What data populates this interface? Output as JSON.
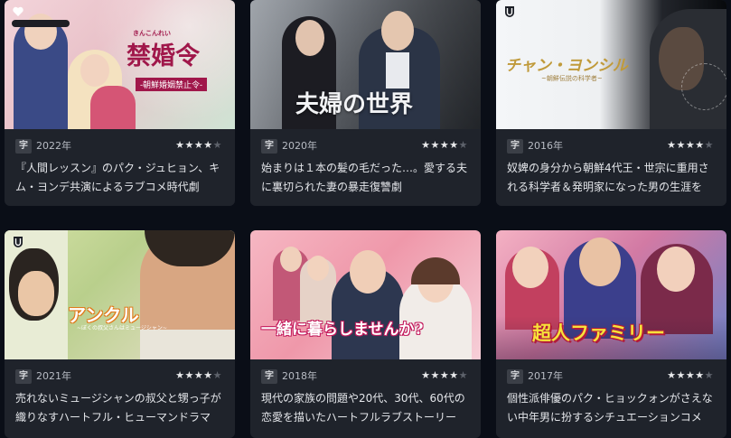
{
  "cards": [
    {
      "title_art": "禁婚令",
      "title_ruby": "きんこんれい",
      "title_sub": "-朝鮮婚姻禁止令-",
      "subtitle_badge": "字",
      "year": "2022年",
      "rating": 4,
      "description": "『人間レッスン』のパク・ジュヒョン、キム・ヨンデ共演によるラブコメ時代劇",
      "badge_icon": "heart-icon"
    },
    {
      "title_art": "夫婦の世界",
      "subtitle_badge": "字",
      "year": "2020年",
      "rating": 4,
      "description": "始まりは１本の髪の毛だった…。愛する夫に裏切られた妻の暴走復讐劇"
    },
    {
      "title_art": "チャン・ヨンシル",
      "title_sub": "~朝鮮伝説の科学者~",
      "subtitle_badge": "字",
      "year": "2016年",
      "rating": 4,
      "description": "奴婢の身分から朝鮮4代王・世宗に重用される科学者＆発明家になった男の生涯を",
      "badge_icon": "shield-icon"
    },
    {
      "title_art": "アンクル",
      "title_sub": "~ぼくの叔父さんはミュージシャン~",
      "subtitle_badge": "字",
      "year": "2021年",
      "rating": 4,
      "description": "売れないミュージシャンの叔父と甥っ子が織りなすハートフル・ヒューマンドラマ",
      "badge_icon": "shield-icon"
    },
    {
      "title_art": "一緒に暮らしませんか?",
      "subtitle_badge": "字",
      "year": "2018年",
      "rating": 4,
      "description": "現代の家族の問題や20代、30代、60代の恋愛を描いたハートフルラブストーリー"
    },
    {
      "title_art": "超人ファミリー",
      "subtitle_badge": "字",
      "year": "2017年",
      "rating": 4,
      "description": "個性派俳優のパク・ヒョックォンがさえない中年男に扮するシチュエーションコメ"
    }
  ],
  "colors": {
    "page_bg": "#0a0e17",
    "card_bg": "#1f232b",
    "star_on": "#e8e9eb",
    "star_off": "#5d626b"
  }
}
